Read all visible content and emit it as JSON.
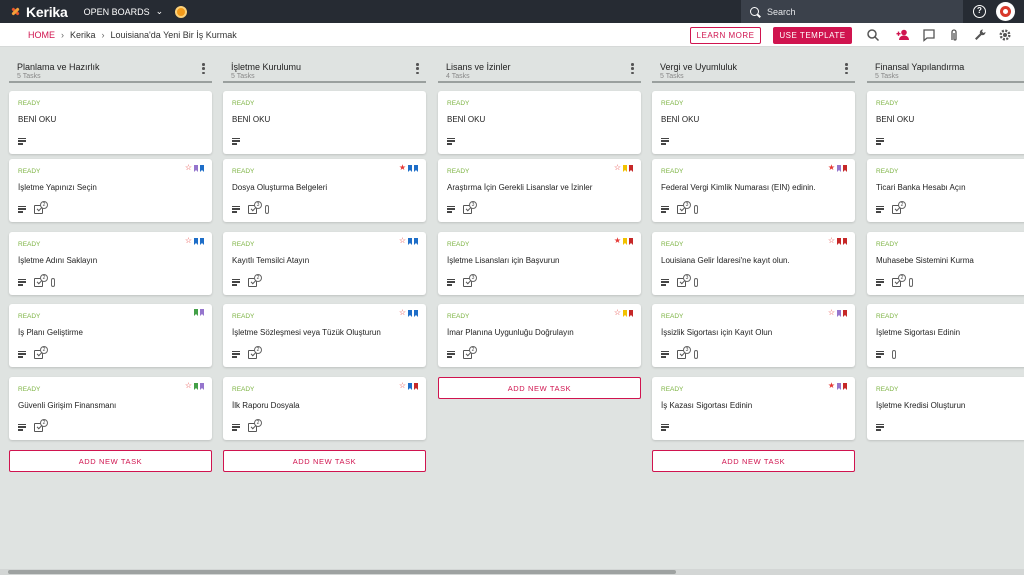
{
  "app": {
    "logo": "Kerika",
    "open_boards": "OPEN BOARDS"
  },
  "search": {
    "placeholder": "Search"
  },
  "breadcrumb": {
    "home": "HOME",
    "level1": "Kerika",
    "level2": "Louisiana'da Yeni Bir İş Kurmak"
  },
  "actions": {
    "learn_more": "LEARN MORE",
    "use_template": "USE TEMPLATE",
    "add_task": "ADD NEW TASK"
  },
  "colors": {
    "accent": "#d0144f",
    "ready": "#7cb342",
    "topbar": "#262b33",
    "purple": "#9575cd",
    "blue": "#1e6ec8",
    "red": "#c62828",
    "yellow": "#f2c200",
    "green": "#43a047"
  },
  "columns": [
    {
      "title": "Planlama ve Hazırlık",
      "count": "5 Tasks",
      "cards": [
        {
          "status": "READY",
          "title": "BENİ OKU",
          "checklist": "",
          "attach": false,
          "star": "",
          "tags": []
        },
        {
          "status": "READY",
          "title": "İşletme Yapınızı Seçin",
          "checklist": "2",
          "attach": false,
          "star": "outline",
          "tags": [
            "purple",
            "blue"
          ]
        },
        {
          "status": "READY",
          "title": "İşletme Adını Saklayın",
          "checklist": "2",
          "attach": true,
          "star": "outline",
          "tags": [
            "blue",
            "blue"
          ]
        },
        {
          "status": "READY",
          "title": "İş Planı Geliştirme",
          "checklist": "2",
          "attach": false,
          "star": "",
          "tags": [
            "green",
            "purple"
          ]
        },
        {
          "status": "READY",
          "title": "Güvenli Girişim Finansmanı",
          "checklist": "2",
          "attach": false,
          "star": "outline",
          "tags": [
            "green",
            "purple"
          ]
        }
      ]
    },
    {
      "title": "İşletme Kurulumu",
      "count": "5 Tasks",
      "cards": [
        {
          "status": "READY",
          "title": "BENİ OKU",
          "checklist": "",
          "attach": false,
          "star": "",
          "tags": []
        },
        {
          "status": "READY",
          "title": "Dosya Oluşturma Belgeleri",
          "checklist": "3",
          "attach": true,
          "star": "filled",
          "tags": [
            "blue",
            "blue"
          ]
        },
        {
          "status": "READY",
          "title": "Kayıtlı Temsilci Atayın",
          "checklist": "2",
          "attach": false,
          "star": "outline",
          "tags": [
            "blue",
            "blue"
          ]
        },
        {
          "status": "READY",
          "title": "İşletme Sözleşmesi veya Tüzük Oluşturun",
          "checklist": "2",
          "attach": false,
          "star": "outline",
          "tags": [
            "blue",
            "blue"
          ]
        },
        {
          "status": "READY",
          "title": "İlk Raporu Dosyala",
          "checklist": "2",
          "attach": false,
          "star": "outline",
          "tags": [
            "blue",
            "red"
          ]
        }
      ]
    },
    {
      "title": "Lisans ve İzinler",
      "count": "4 Tasks",
      "cards": [
        {
          "status": "READY",
          "title": "BENİ OKU",
          "checklist": "",
          "attach": false,
          "star": "",
          "tags": []
        },
        {
          "status": "READY",
          "title": "Araştırma İçin Gerekli Lisanslar ve İzinler",
          "checklist": "3",
          "attach": false,
          "star": "outline",
          "tags": [
            "yellow",
            "red"
          ]
        },
        {
          "status": "READY",
          "title": "İşletme Lisansları için Başvurun",
          "checklist": "3",
          "attach": false,
          "star": "filled",
          "tags": [
            "yellow",
            "red"
          ]
        },
        {
          "status": "READY",
          "title": "İmar Planına Uygunluğu Doğrulayın",
          "checklist": "2",
          "attach": false,
          "star": "outline",
          "tags": [
            "yellow",
            "red"
          ]
        }
      ]
    },
    {
      "title": "Vergi ve Uyumluluk",
      "count": "5 Tasks",
      "cards": [
        {
          "status": "READY",
          "title": "BENİ OKU",
          "checklist": "",
          "attach": false,
          "star": "",
          "tags": []
        },
        {
          "status": "READY",
          "title": "Federal Vergi Kimlik Numarası (EIN) edinin.",
          "checklist": "3",
          "attach": true,
          "star": "filled",
          "tags": [
            "purple",
            "red"
          ]
        },
        {
          "status": "READY",
          "title": "Louisiana Gelir İdaresi'ne kayıt olun.",
          "checklist": "3",
          "attach": true,
          "star": "outline",
          "tags": [
            "red",
            "red"
          ]
        },
        {
          "status": "READY",
          "title": "İşsizlik Sigortası için Kayıt Olun",
          "checklist": "3",
          "attach": true,
          "star": "outline",
          "tags": [
            "purple",
            "red"
          ]
        },
        {
          "status": "READY",
          "title": "İş Kazası Sigortası Edinin",
          "checklist": "",
          "attach": false,
          "star": "filled",
          "tags": [
            "purple",
            "red"
          ]
        }
      ]
    },
    {
      "title": "Finansal Yapılandırma",
      "count": "5 Tasks",
      "cards": [
        {
          "status": "READY",
          "title": "BENİ OKU",
          "checklist": "",
          "attach": false,
          "star": "",
          "tags": []
        },
        {
          "status": "READY",
          "title": "Ticari Banka Hesabı Açın",
          "checklist": "2",
          "attach": false,
          "star": "",
          "tags": []
        },
        {
          "status": "READY",
          "title": "Muhasebe Sistemini Kurma",
          "checklist": "2",
          "attach": true,
          "star": "",
          "tags": []
        },
        {
          "status": "READY",
          "title": "İşletme Sigortası Edinin",
          "checklist": "",
          "attach": true,
          "star": "",
          "tags": []
        },
        {
          "status": "READY",
          "title": "İşletme Kredisi Oluşturun",
          "checklist": "",
          "attach": false,
          "star": "",
          "tags": []
        }
      ]
    }
  ]
}
